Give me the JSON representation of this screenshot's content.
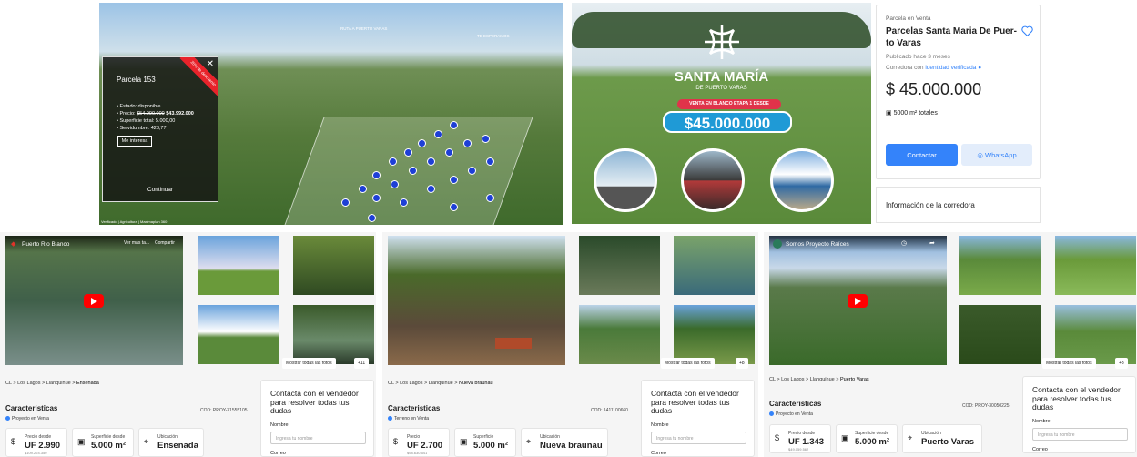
{
  "aerial": {
    "popup_title": "Parcela 153",
    "ribbon": "20% de descuento",
    "status": "Estado: disponible",
    "price_label": "Precio:",
    "price_old": "$54.990.000",
    "price_new": "$43.992.000",
    "surface": "Superficie total: 5.000,00",
    "easement": "Servidumbre: 428,77",
    "interest_button": "Me interesa",
    "continue_button": "Continuar",
    "map_label_1": "RUTA A PUERTO VARAS",
    "map_label_2": "TE ESPERAMOS",
    "credit": "Verificado | Agricultura | Maximaplan 360"
  },
  "ad": {
    "brand": "SANTA MARÍA",
    "brand_sub": "DE PUERTO VARAS",
    "sale_tag": "VENTA EN BLANCO ETAPA 1 DESDE",
    "price": "$45.000.000"
  },
  "listing": {
    "category": "Parcela en Venta",
    "title": "Parcelas Santa Maria De Puer-to Varas",
    "published": "Publicado hace 3 meses",
    "broker_prefix": "Corredora con",
    "broker_link": "identidad verificada",
    "price": "$ 45.000.000",
    "area": "5000 m² totales",
    "contact_button": "Contactar",
    "whatsapp_button": "WhatsApp",
    "broker_info": "Información de la corredora"
  },
  "projects": [
    {
      "video_title": "Puerto Rio Blanco",
      "video_actions": [
        "Ver más ta...",
        "Compartir"
      ],
      "show_all": "Mostrar todas las fotos",
      "photo_count": "+11",
      "breadcrumb": [
        "CL",
        "Los Lagos",
        "Llanquihue",
        "Ensenada"
      ],
      "section_title": "Caracteristicas",
      "code": "COD: PROY-31555105",
      "tag": "Proyecto en Venta",
      "price_label": "Precio desde",
      "price_value": "UF 2.990",
      "price_sub": "$109.224.350",
      "surface_label": "Superficie desde",
      "surface_value": "5.000 m²",
      "location_label": "Ubicación",
      "location_value": "Ensenada",
      "contact_title": "Contacta con el vendedor para resolver todas tus dudas",
      "name_label": "Nombre",
      "name_placeholder": "Ingresa tu nombre",
      "email_label": "Correo"
    },
    {
      "show_all": "Mostrar todas las fotos",
      "photo_count": "+8",
      "breadcrumb": [
        "CL",
        "Los Lagos",
        "Llanquihue",
        "Nueva braunau"
      ],
      "section_title": "Caracteristicas",
      "code": "COD: 1411100660",
      "tag": "Terreno en Venta",
      "price_label": "Precio",
      "price_value": "UF 2.700",
      "price_sub": "$98.630,541",
      "surface_label": "Superficie",
      "surface_value": "5.000 m²",
      "location_label": "Ubicación",
      "location_value": "Nueva braunau",
      "contact_title": "Contacta con el vendedor para resolver todas tus dudas",
      "name_label": "Nombre",
      "name_placeholder": "Ingresa tu nombre",
      "email_label": "Correo"
    },
    {
      "video_title": "Somos Proyecto Raíces",
      "show_all": "Mostrar todas las fotos",
      "photo_count": "+3",
      "breadcrumb": [
        "CL",
        "Los Lagos",
        "Llanquihue",
        "Puerto Varas"
      ],
      "section_title": "Caracteristicas",
      "code": "COD: PROY-30050225",
      "tag": "Proyecto en Venta",
      "price_label": "Precio desde",
      "price_value": "UF 1.343",
      "price_sub": "$49.059.562",
      "surface_label": "Superficie desde",
      "surface_value": "5.000 m²",
      "location_label": "Ubicación",
      "location_value": "Puerto Varas",
      "contact_title": "Contacta con el vendedor para resolver todas tus dudas",
      "name_label": "Nombre",
      "name_placeholder": "Ingresa tu nombre",
      "email_label": "Correo"
    }
  ],
  "colors": {
    "accent": "#3483fa",
    "ribbon": "#e8232b",
    "ad_pill_red": "#e0334a",
    "ad_pill_blue": "#1f9ad6"
  }
}
